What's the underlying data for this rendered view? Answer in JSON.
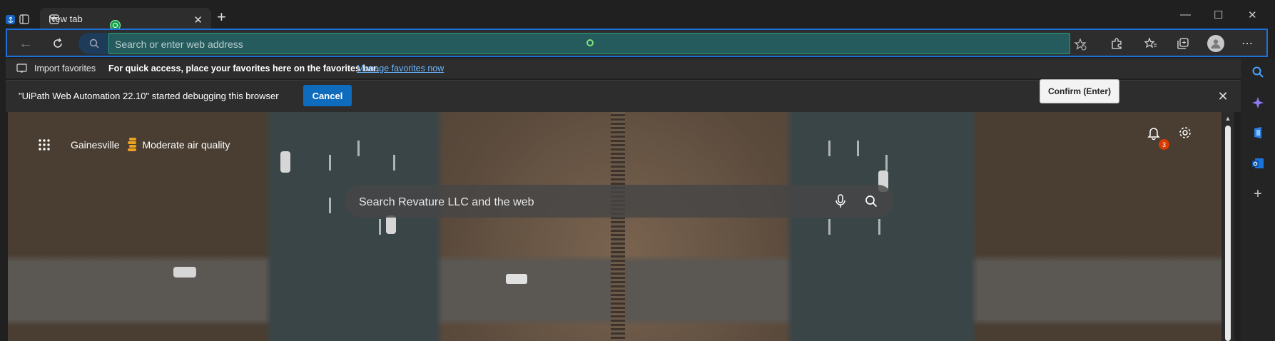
{
  "tab": {
    "title": "New tab"
  },
  "address_bar": {
    "placeholder": "Search or enter web address"
  },
  "favorites_bar": {
    "import_label": "Import favorites",
    "hint": "For quick access, place your favorites here on the favorites bar.",
    "manage_link": "Manage favorites now"
  },
  "debug_notice": {
    "message": "\"UiPath Web Automation 22.10\" started debugging this browser",
    "cancel_label": "Cancel"
  },
  "tooltip": {
    "text": "Confirm (Enter)"
  },
  "newtab_page": {
    "location": "Gainesville",
    "air_quality": "Moderate air quality",
    "search_placeholder": "Search Revature LLC and the web",
    "notification_count": "3"
  },
  "colors": {
    "accent": "#0f6cbd",
    "selection_border": "#1e6fd9",
    "address_highlight": "#255b5d"
  },
  "icons": [
    "uipath-anchor-icon",
    "sidebar-toggle-icon",
    "new-tab-page-icon",
    "close-icon",
    "plus-icon",
    "minimize-icon",
    "maximize-icon",
    "back-icon",
    "refresh-icon",
    "search-icon",
    "favorite-add-icon",
    "extensions-icon",
    "favorites-icon",
    "collections-icon",
    "profile-icon",
    "more-icon",
    "apps-grid-icon",
    "air-quality-icon",
    "mic-icon",
    "bell-icon",
    "gear-icon",
    "copilot-icon",
    "office-icon",
    "outlook-icon"
  ]
}
